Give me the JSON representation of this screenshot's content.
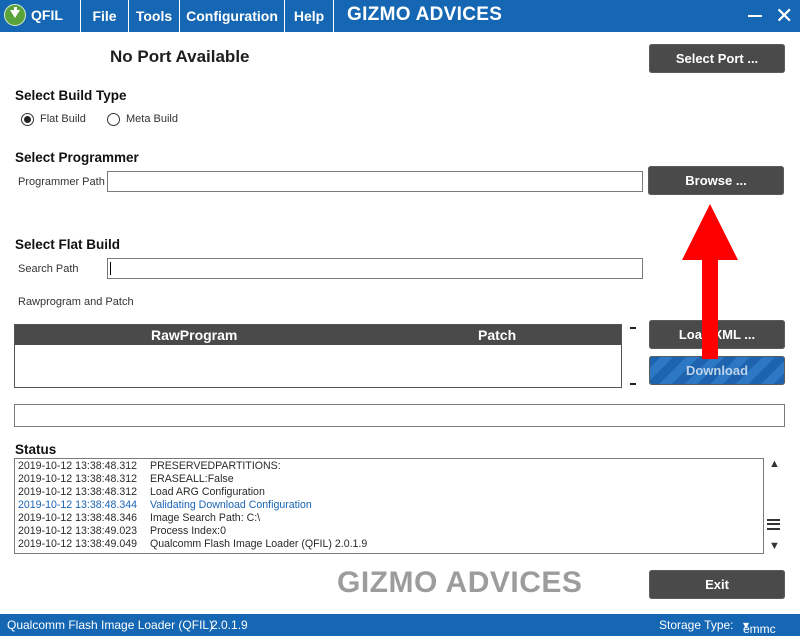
{
  "app": {
    "name": "QFIL",
    "brand": "GIZMO ADVICES",
    "menu": [
      "File",
      "Tools",
      "Configuration",
      "Help"
    ]
  },
  "port": {
    "status": "No Port Available",
    "select_label": "Select Port ..."
  },
  "build_type": {
    "title": "Select Build Type",
    "options": [
      "Flat Build",
      "Meta Build"
    ],
    "selected": "Flat Build"
  },
  "programmer": {
    "title": "Select Programmer",
    "path_label": "Programmer Path",
    "path_value": "",
    "browse_label": "Browse ..."
  },
  "flat_build": {
    "title": "Select Flat Build",
    "search_label": "Search Path",
    "search_value": "",
    "rawprogram_label": "Rawprogram and Patch",
    "columns": [
      "RawProgram",
      "Patch"
    ],
    "load_xml_label": "Load XML ...",
    "download_label": "Download"
  },
  "status": {
    "title": "Status",
    "log": [
      {
        "time": "2019-10-12 13:38:48.312",
        "text": "PRESERVEDPARTITIONS:",
        "highlight": false
      },
      {
        "time": "2019-10-12 13:38:48.312",
        "text": "ERASEALL:False",
        "highlight": false
      },
      {
        "time": "2019-10-12 13:38:48.312",
        "text": "Load ARG Configuration",
        "highlight": false
      },
      {
        "time": "2019-10-12 13:38:48.344",
        "text": "Validating Download Configuration",
        "highlight": true
      },
      {
        "time": "2019-10-12 13:38:48.346",
        "text": "Image Search Path: C:\\",
        "highlight": false
      },
      {
        "time": "2019-10-12 13:38:49.023",
        "text": "Process Index:0",
        "highlight": false
      },
      {
        "time": "2019-10-12 13:38:49.049",
        "text": "Qualcomm Flash Image Loader (QFIL) 2.0.1.9",
        "highlight": false
      }
    ]
  },
  "exit_label": "Exit",
  "watermark": "GIZMO ADVICES",
  "footer": {
    "app_title": "Qualcomm Flash Image Loader (QFIL)",
    "version": "2.0.1.9",
    "storage_label": "Storage Type:",
    "storage_value": "emmc"
  },
  "icons": {
    "logo": "download-arrow-icon",
    "minimize": "minimize-icon",
    "close": "close-icon",
    "annotation": "red-arrow-icon"
  },
  "colors": {
    "title_bar": "#1567b3",
    "button": "#4a4a4a",
    "download": "#1e63ad",
    "log_highlight": "#1a63b5",
    "annotation_arrow": "#ff0000",
    "watermark": "#9c9c9c"
  }
}
